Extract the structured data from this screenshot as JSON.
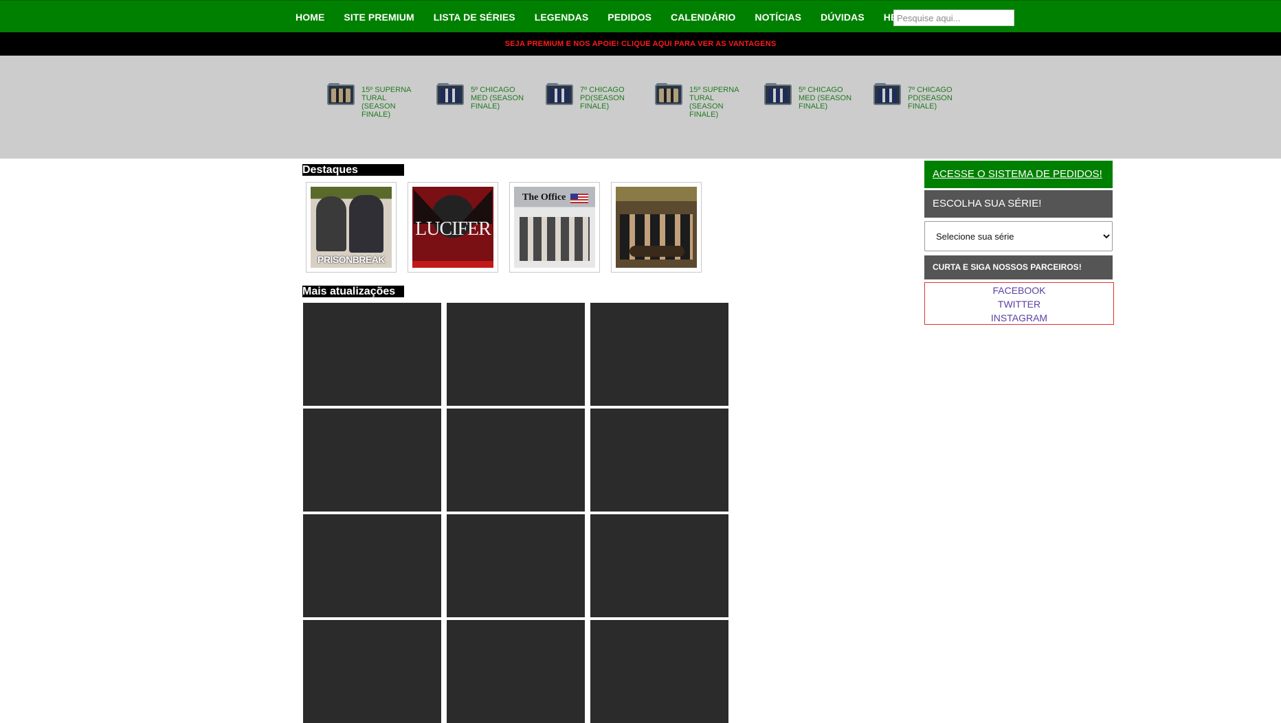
{
  "nav": {
    "items": [
      "HOME",
      "SITE PREMIUM",
      "LISTA DE SÉRIES",
      "LEGENDAS",
      "PEDIDOS",
      "CALENDÁRIO",
      "NOTÍCIAS",
      "DÚVIDAS",
      "HENTAI"
    ],
    "search_placeholder": "Pesquise aqui..."
  },
  "premium_banner": "SEJA PREMIUM E NOS APOIE! CLIQUE AQUI PARA VER AS VANTAGENS",
  "ticker": [
    {
      "label": "15º SUPERNA TURAL (SEASON FINALE)",
      "icon": "supernatural-folder-icon"
    },
    {
      "label": "5º CHICAGO MED (SEASON FINALE)",
      "icon": "chicago-med-folder-icon"
    },
    {
      "label": "7º CHICAGO PD(SEASON FINALE)",
      "icon": "chicago-pd-folder-icon"
    },
    {
      "label": "15º SUPERNA TURAL (SEASON FINALE)",
      "icon": "supernatural-folder-icon"
    },
    {
      "label": "5º CHICAGO MED (SEASON FINALE)",
      "icon": "chicago-med-folder-icon"
    },
    {
      "label": "7º CHICAGO PD(SEASON FINALE)",
      "icon": "chicago-pd-folder-icon"
    }
  ],
  "highlights": {
    "title": "Destaques",
    "items": [
      {
        "name": "prison-break",
        "text": "PRISONBREAK"
      },
      {
        "name": "lucifer",
        "text": "LUCIFER"
      },
      {
        "name": "the-office",
        "text": "The Office"
      },
      {
        "name": "how-i-met-your-mother",
        "text": ""
      }
    ]
  },
  "updates": {
    "title": "Mais atualizações"
  },
  "sidebar": {
    "orders_button": "ACESSE O SISTEMA DE PEDIDOS!",
    "choose_series": "ESCOLHA SUA SÉRIE!",
    "select_value": "Selecione sua série",
    "partners_heading": "CURTA E SIGA NOSSOS PARCEIROS!",
    "social": [
      "FACEBOOK",
      "TWITTER",
      "INSTAGRAM"
    ]
  },
  "colors": {
    "nav_bg": "#008000",
    "banner_bg": "#000000",
    "banner_text": "#ff1a1a",
    "band_bg": "#cccccc",
    "ticker_text": "#1f7a1f",
    "tile_bg": "#2b2b2b",
    "social_link": "#5b3fa0",
    "social_border": "#e03030"
  }
}
